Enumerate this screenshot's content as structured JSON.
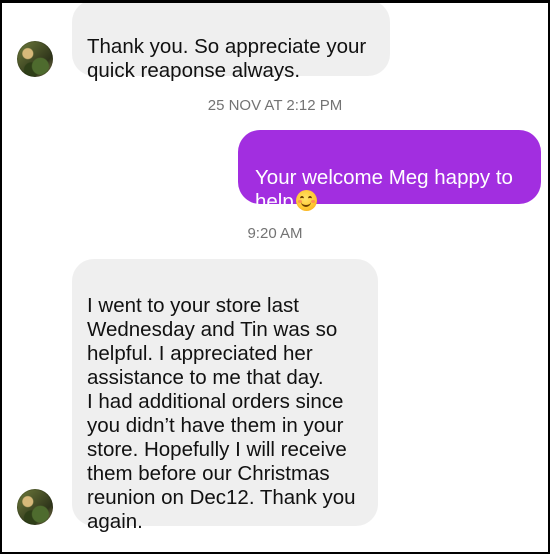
{
  "conversation": {
    "messages": [
      {
        "direction": "incoming",
        "text": "Thank you. So appreciate your\nquick reaponse always."
      },
      {
        "direction": "outgoing",
        "text": "Your welcome Meg happy to\nhelp",
        "emoji": "smiling-face-with-smiling-eyes"
      },
      {
        "direction": "incoming",
        "text": "I went to your store last\nWednesday and Tin was so\nhelpful. I appreciated her\nassistance to me that day.\nI had additional orders since\nyou didn’t have them in your\nstore. Hopefully I will receive\nthem before our Christmas\nreunion on Dec12. Thank you\nagain."
      }
    ],
    "timestamps": [
      "25 NOV AT 2:12 PM",
      "9:20 AM"
    ]
  },
  "colors": {
    "outgoing_bubble": "#a22ee0",
    "incoming_bubble": "#efefef",
    "timestamp_text": "#737373"
  }
}
